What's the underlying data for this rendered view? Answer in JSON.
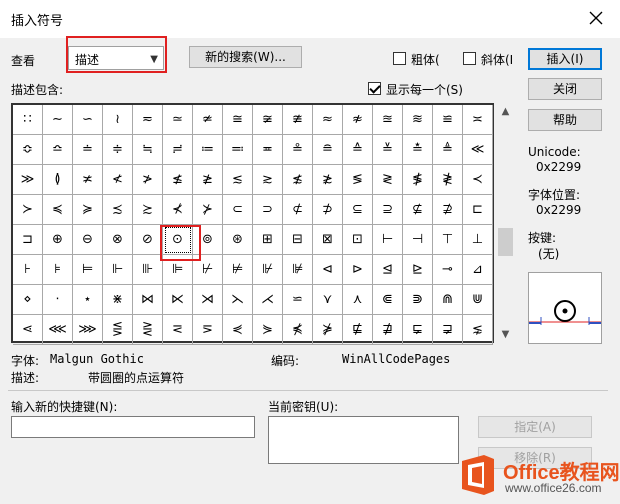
{
  "window": {
    "title": "插入符号"
  },
  "view": {
    "label": "查看",
    "value": "描述"
  },
  "search_button": "新的搜索(W)...",
  "bold_label": "粗体(",
  "italic_label": "斜体(I",
  "buttons": {
    "insert": "插入(I)",
    "close": "关闭",
    "help": "帮助",
    "assign": "指定(A)",
    "remove": "移除(R)"
  },
  "desc_contains": "描述包含:",
  "show_each": "显示每一个(S)",
  "symbols": [
    [
      "∷",
      "∼",
      "∽",
      "≀",
      "≂",
      "≃",
      "≄",
      "≅",
      "≆",
      "≇",
      "≈",
      "≉",
      "≊",
      "≋",
      "≌",
      "≍"
    ],
    [
      "≎",
      "≏",
      "≐",
      "≑",
      "≒",
      "≓",
      "≔",
      "≕",
      "≖",
      "≗",
      "≘",
      "≙",
      "≚",
      "≛",
      "≜",
      "≪"
    ],
    [
      "≫",
      "≬",
      "≭",
      "≮",
      "≯",
      "≰",
      "≱",
      "≲",
      "≳",
      "≴",
      "≵",
      "≶",
      "≷",
      "≸",
      "≹",
      "≺"
    ],
    [
      "≻",
      "≼",
      "≽",
      "≾",
      "≿",
      "⊀",
      "⊁",
      "⊂",
      "⊃",
      "⊄",
      "⊅",
      "⊆",
      "⊇",
      "⊈",
      "⊉",
      "⊏"
    ],
    [
      "⊐",
      "⊕",
      "⊖",
      "⊗",
      "⊘",
      "⊙",
      "⊚",
      "⊛",
      "⊞",
      "⊟",
      "⊠",
      "⊡",
      "⊢",
      "⊣",
      "⊤",
      "⊥"
    ],
    [
      "⊦",
      "⊧",
      "⊨",
      "⊩",
      "⊪",
      "⊫",
      "⊬",
      "⊭",
      "⊮",
      "⊯",
      "⊲",
      "⊳",
      "⊴",
      "⊵",
      "⊸",
      "⊿"
    ],
    [
      "⋄",
      "⋅",
      "⋆",
      "⋇",
      "⋈",
      "⋉",
      "⋊",
      "⋋",
      "⋌",
      "⋍",
      "⋎",
      "⋏",
      "⋐",
      "⋑",
      "⋒",
      "⋓"
    ],
    [
      "⋖",
      "⋘",
      "⋙",
      "⋚",
      "⋛",
      "⋜",
      "⋝",
      "⋞",
      "⋟",
      "⋠",
      "⋡",
      "⋢",
      "⋣",
      "⋤",
      "⋥",
      "⋦"
    ]
  ],
  "selected_symbol": "⊙",
  "unicode": {
    "label": "Unicode:",
    "value": "0x2299"
  },
  "font_pos": {
    "label": "字体位置:",
    "value": "0x2299"
  },
  "key": {
    "label": "按键:",
    "value": "(无)"
  },
  "font": {
    "label": "字体:",
    "value": "Malgun Gothic"
  },
  "encoding": {
    "label": "编码:",
    "value": "WinAllCodePages"
  },
  "description": {
    "label": "描述:",
    "value": "带圆圈的点运算符"
  },
  "new_shortcut_label": "输入新的快捷键(N):",
  "current_key_label": "当前密钥(U):",
  "watermark": {
    "brand": "Office教程网",
    "url": "www.office26.com"
  },
  "colors": {
    "highlight": "#e02020",
    "brand": "#e8541e",
    "focus": "#0078d7"
  }
}
